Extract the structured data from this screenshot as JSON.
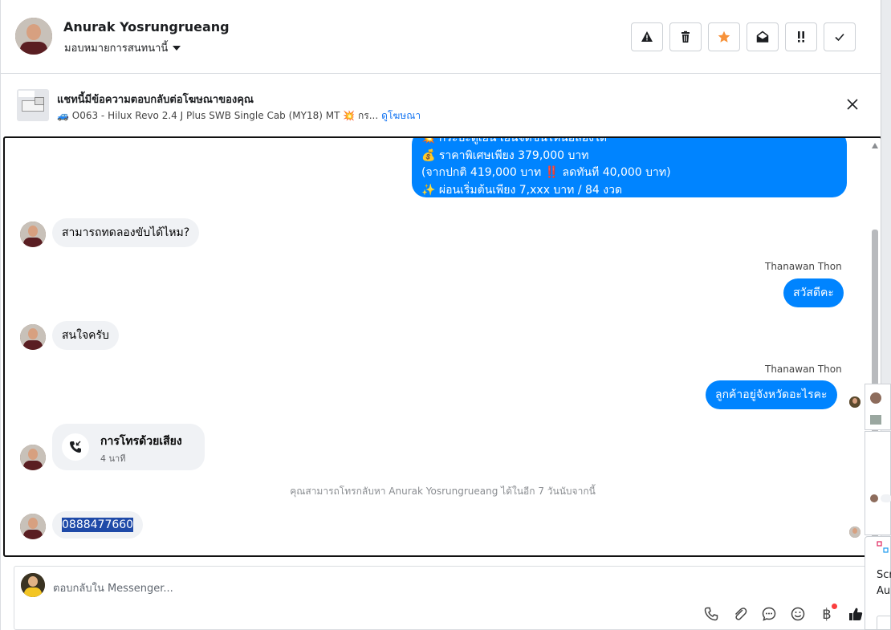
{
  "header": {
    "name": "Anurak Yosrungrueang",
    "assign_label": "มอบหมายการสนทนานี้"
  },
  "actions": [
    "warning-icon",
    "trash-icon",
    "star-icon",
    "envelope-open-icon",
    "important-icon",
    "check-icon"
  ],
  "colors": {
    "accent": "#1877f2",
    "bubble_out": "#0084ff",
    "star": "#f7923a",
    "bubble_in": "#f0f2f5"
  },
  "ad": {
    "title": "แชทนี้มีข้อความตอบกลับต่อโฆษณาของคุณ",
    "desc": "🚙 O063 - Hilux Revo 2.4 J Plus SWB Single Cab (MY18) MT 💥 กร...",
    "link": "ดูโฆษณา"
  },
  "messages": {
    "promo": [
      "💥 กระบะตู้เย็น เย็นจัดขนไหนอลองได้",
      "💰 ราคาพิเศษเพียง 379,000 บาท",
      "(จากปกติ 419,000 บาท ‼️ ลดทันที 40,000 บาท)",
      "✨ ผ่อนเริ่มต้นเพียง 7,xxx บาท / 84 งวด"
    ],
    "in1": "สามารถทดลองขับได้ไหม?",
    "sender1": "Thanawan Thon",
    "out1": "สวัสดีคะ",
    "in2": "สนใจครับ",
    "sender2": "Thanawan Thon",
    "out2": "ลูกค้าอยู่จังหวัดอะไรคะ",
    "call_title": "การโทรด้วยเสียง",
    "call_duration": "4 นาที",
    "system_note": "คุณสามารถโทรกลับหา Anurak Yosrungrueang ได้ในอีก 7 วันนับจากนี้",
    "phone": "0888477660"
  },
  "composer": {
    "placeholder": "ตอบกลับใน Messenger..."
  },
  "overlay": {
    "line1": "Scr",
    "line2": "Au"
  }
}
